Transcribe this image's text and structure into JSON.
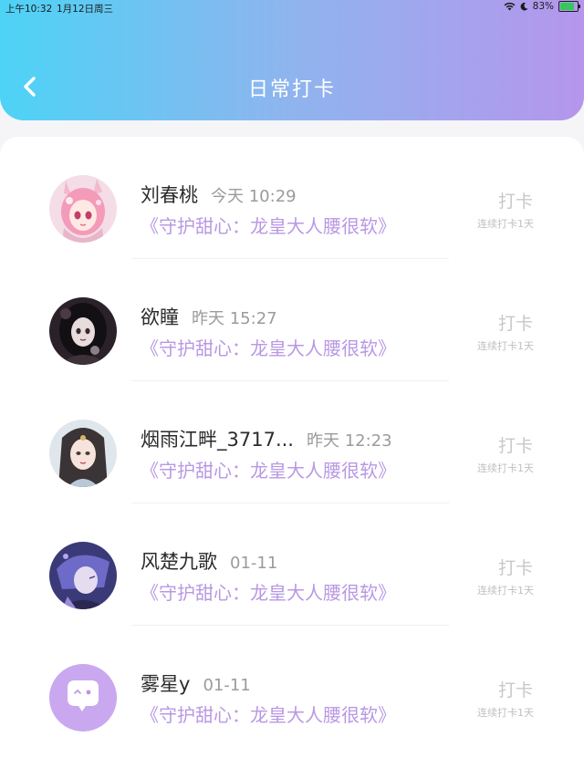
{
  "status_bar": {
    "time": "上午10:32",
    "date": "1月12日周三",
    "battery": "83%"
  },
  "header": {
    "title": "日常打卡",
    "colors": {
      "gradient_start": "#4dd3f6",
      "gradient_end": "#b596ec"
    }
  },
  "items": [
    {
      "name": "刘春桃",
      "time": "今天 10:29",
      "book": "《守护甜心：龙皇大人腰很软》",
      "checkin": "打卡",
      "streak": "连续打卡1天",
      "avatar_icon": "avatar-pink-anime-girl"
    },
    {
      "name": "欲瞳",
      "time": "昨天 15:27",
      "book": "《守护甜心：龙皇大人腰很软》",
      "checkin": "打卡",
      "streak": "连续打卡1天",
      "avatar_icon": "avatar-dark-gothic-girl"
    },
    {
      "name": "烟雨江畔_3717...",
      "time": "昨天 12:23",
      "book": "《守护甜心：龙皇大人腰很软》",
      "checkin": "打卡",
      "streak": "连续打卡1天",
      "avatar_icon": "avatar-ancient-style-girl"
    },
    {
      "name": "风楚九歌",
      "time": "01-11",
      "book": "《守护甜心：龙皇大人腰很软》",
      "checkin": "打卡",
      "streak": "连续打卡1天",
      "avatar_icon": "avatar-purple-anime-boy"
    },
    {
      "name": "雾星y",
      "time": "01-11",
      "book": "《守护甜心：龙皇大人腰很软》",
      "checkin": "打卡",
      "streak": "连续打卡1天",
      "avatar_icon": "avatar-default-chat-bubble"
    }
  ]
}
